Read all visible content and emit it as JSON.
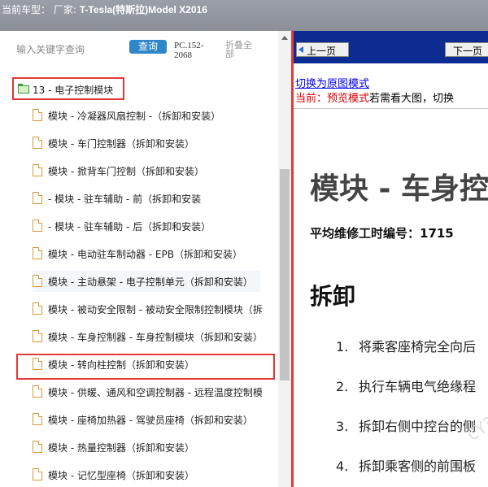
{
  "header": {
    "prefix": "当前车型：",
    "maker_label": "厂家:",
    "model": "T-Tesla(特斯拉)Model X2016"
  },
  "left": {
    "search_placeholder": "输入关键字查询",
    "query_button": "查询",
    "pc_code": "PC.152-2068",
    "collapse_all": "折叠全部",
    "tree_root": "13 - 电子控制模块",
    "items": [
      "模块 - 冷凝器风扇控制 -（拆卸和安装）",
      "模块 - 车门控制器（拆卸和安装）",
      "模块 - 掀背车门控制（拆卸和安装）",
      "- 模块 - 驻车辅助 - 前（拆卸和安装",
      "- 模块 - 驻车辅助 - 后（拆卸和安装）",
      "模块 - 电动驻车制动器 - EPB（拆卸和安装）",
      "模块 - 主动悬架 - 电子控制单元（拆卸和安装）",
      "模块 - 被动安全限制 - 被动安全限制控制模块（拆",
      "模块 - 车身控制器 - 车身控制模块（拆卸和安装）",
      "模块 - 转向柱控制（拆卸和安装）",
      "模块 - 供暖、通风和空调控制器 - 远程温度控制模",
      "模块 - 座椅加热器 - 驾驶员座椅（拆卸和安装）",
      "模块 - 热量控制器（拆卸和安装）",
      "模块 - 记忆型座椅（拆卸和安装）"
    ]
  },
  "right": {
    "prev_button": "上一页",
    "next_button": "下一页",
    "switch_link": "切换为原图模式",
    "mode_current": "当前：预览模式",
    "mode_hint": "若需看大图，切换",
    "doc_title": "模块 - 车身控",
    "labor_code": "平均维修工时编号：1715",
    "section_title": "拆卸",
    "steps": [
      {
        "num": "1.",
        "text": "将乘客座椅完全向后"
      },
      {
        "num": "2.",
        "text": "执行车辆电气绝缘程"
      },
      {
        "num": "3.",
        "text": "拆卸右侧中控台的侧"
      },
      {
        "num": "4.",
        "text": "拆卸乘客侧的前围板"
      }
    ],
    "watermark": "CY385"
  }
}
